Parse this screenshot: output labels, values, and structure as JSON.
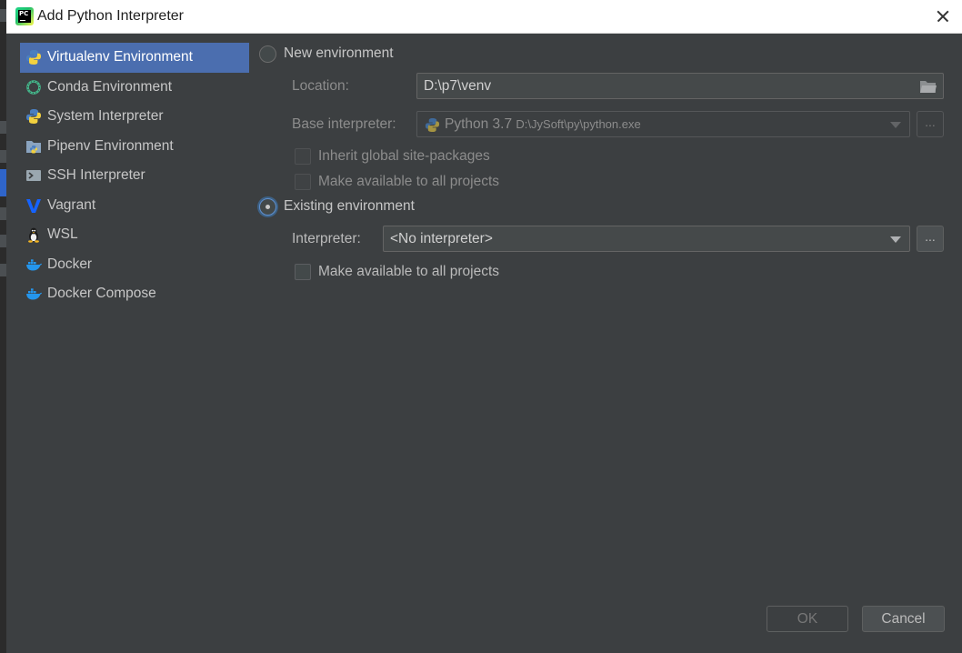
{
  "window": {
    "title": "Add Python Interpreter"
  },
  "sidebar": {
    "items": [
      {
        "label": "Virtualenv Environment",
        "icon": "virtualenv-icon",
        "selected": true
      },
      {
        "label": "Conda Environment",
        "icon": "conda-icon",
        "selected": false
      },
      {
        "label": "System Interpreter",
        "icon": "python-icon",
        "selected": false
      },
      {
        "label": "Pipenv Environment",
        "icon": "pipenv-icon",
        "selected": false
      },
      {
        "label": "SSH Interpreter",
        "icon": "terminal-icon",
        "selected": false
      },
      {
        "label": "Vagrant",
        "icon": "vagrant-icon",
        "selected": false
      },
      {
        "label": "WSL",
        "icon": "linux-penguin-icon",
        "selected": false
      },
      {
        "label": "Docker",
        "icon": "docker-icon",
        "selected": false
      },
      {
        "label": "Docker Compose",
        "icon": "docker-compose-icon",
        "selected": false
      }
    ]
  },
  "new_env": {
    "radio_label": "New environment",
    "selected": false,
    "location_label": "Location:",
    "location_value": "D:\\p7\\venv",
    "base_label": "Base interpreter:",
    "base_name": "Python 3.7",
    "base_path": "D:\\JySoft\\py\\python.exe",
    "inherit_label": "Inherit global site-packages",
    "make_available_label": "Make available to all projects",
    "ellipsis": "..."
  },
  "existing_env": {
    "radio_label": "Existing environment",
    "selected": true,
    "interpreter_label": "Interpreter:",
    "interpreter_value": "<No interpreter>",
    "make_available_label": "Make available to all projects",
    "ellipsis": "..."
  },
  "footer": {
    "ok_label": "OK",
    "cancel_label": "Cancel"
  },
  "colors": {
    "selection": "#4b6eaf",
    "background": "#3c3f41",
    "title_bar": "#ffffff"
  }
}
